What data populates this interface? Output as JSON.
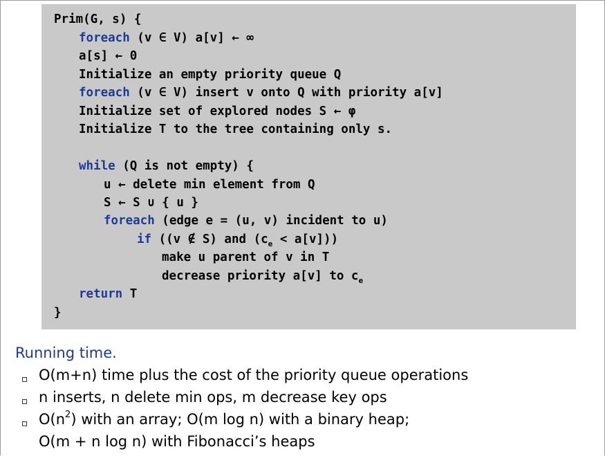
{
  "code": {
    "l1": "Prim(G, s) {",
    "l2_kw": "foreach",
    "l2_rest": " (v ∈ V) a[v] ← ∞",
    "l3": "a[s] ← 0",
    "l4": "Initialize an empty priority queue Q",
    "l5_kw": "foreach",
    "l5_rest": " (v ∈ V) insert v onto Q with priority a[v]",
    "l6": "Initialize set of explored nodes S ← φ",
    "l7": "Initialize T to the tree containing only s.",
    "l8_kw": "while",
    "l8_rest": " (Q is not empty) {",
    "l9": "u ← delete min element from Q",
    "l10": "S ← S ∪ { u }",
    "l11_kw": "foreach",
    "l11_rest": " (edge e = (u, v) incident to u)",
    "l12_kw": "if",
    "l12_a": " ((v ∉ S) and (c",
    "l12_sub": "e",
    "l12_b": " < a[v]))",
    "l13": "make u parent of v in T",
    "l14_a": "decrease priority a[v] to c",
    "l14_sub": "e",
    "l15_kw": "return",
    "l15_rest": " T",
    "l16": "}"
  },
  "running_time": {
    "title": "Running time.",
    "b1": "O(m+n) time plus the cost of the priority queue operations",
    "b2": "n inserts, n delete min ops, m decrease key ops",
    "b3_a": "O(n",
    "b3_sup": "2",
    "b3_b": ") with an array; O(m log n) with a binary heap;",
    "b3_line2": "O(m + n log n) with Fibonacci’s heaps"
  }
}
